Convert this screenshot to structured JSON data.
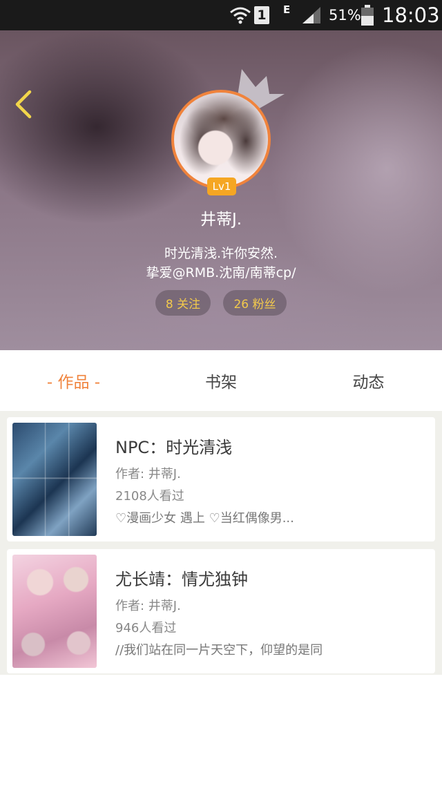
{
  "status_bar": {
    "sim_slot": "1",
    "network_type": "E",
    "battery_percent": "51%",
    "time": "18:03",
    "icons": [
      "wifi-icon",
      "signal-icon",
      "battery-icon"
    ]
  },
  "profile": {
    "level_badge": "Lv1",
    "username": "井蒂J.",
    "bio_line1": "时光清浅.许你安然.",
    "bio_line2": "挚爱@RMB.沈南/南蒂cp/",
    "following_label": "8 关注",
    "fans_label": "26 粉丝"
  },
  "tabs": [
    {
      "label": "- 作品 -",
      "active": true
    },
    {
      "label": "书架",
      "active": false
    },
    {
      "label": "动态",
      "active": false
    }
  ],
  "works": [
    {
      "title": "NPC：时光清浅",
      "author": "作者: 井蒂J.",
      "views": "2108人看过",
      "description": "♡漫画少女 遇上 ♡当红偶像男..."
    },
    {
      "title": "尤长靖：情尤独钟",
      "author": "作者: 井蒂J.",
      "views": "946人看过",
      "description": "//我们站在同一片天空下，仰望的是同一个…"
    }
  ],
  "colors": {
    "accent": "#f0833c",
    "level_badge": "#f5a623",
    "stat_text": "#f2c94c",
    "back_arrow": "#f2d64b"
  }
}
